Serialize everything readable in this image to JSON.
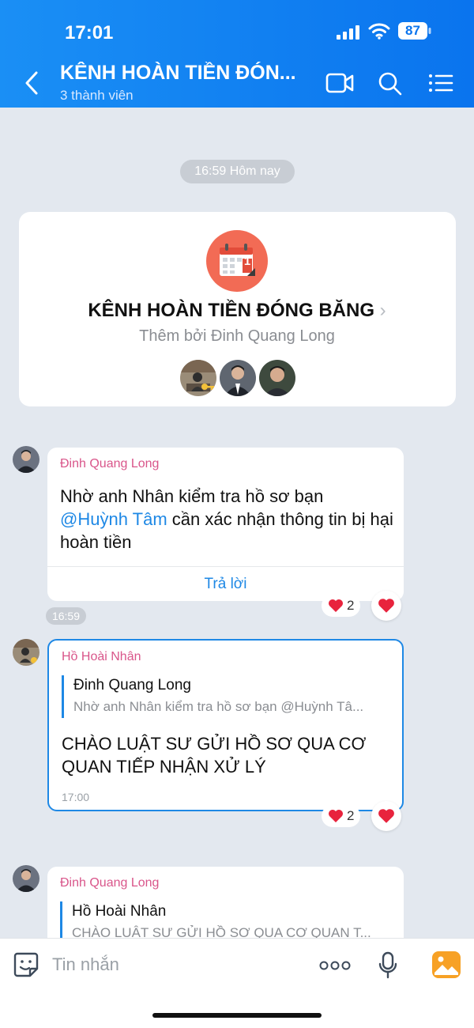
{
  "status": {
    "time": "17:01",
    "battery": "87"
  },
  "header": {
    "title": "KÊNH HOÀN TIỀN ĐÓN...",
    "subtitle": "3 thành viên"
  },
  "date_pill": "16:59 Hôm nay",
  "group_card": {
    "title": "KÊNH HOÀN TIỀN ĐÓNG BĂNG",
    "subtitle": "Thêm bởi Đinh Quang Long",
    "calendar_day": "1"
  },
  "messages": [
    {
      "sender": "Đinh Quang Long",
      "text_before": "Nhờ anh Nhân kiểm tra hồ sơ bạn",
      "mention": "@Huỳnh Tâm",
      "text_after": "cần xác nhận thông tin bị hại hoàn tiền",
      "reply_label": "Trả lời",
      "time": "16:59",
      "reactions": "2"
    },
    {
      "sender": "Hồ Hoài Nhân",
      "quote_name": "Đinh Quang Long",
      "quote_text": "Nhờ anh Nhân kiểm tra hồ sơ bạn @Huỳnh Tâ...",
      "text": "CHÀO LUẬT SƯ GỬI HỒ SƠ QUA CƠ QUAN TIẾP NHẬN XỬ LÝ",
      "time": "17:00",
      "reactions": "2"
    },
    {
      "sender": "Đinh Quang Long",
      "quote_name": "Hồ Hoài Nhân",
      "quote_text": "CHÀO LUẬT SƯ GỬI HỒ SƠ QUA CƠ QUAN T..."
    }
  ],
  "input": {
    "placeholder": "Tin nhắn"
  },
  "colors": {
    "header": "#0a74ee",
    "accent": "#1e88e5",
    "sender": "#d9558a",
    "background": "#e3e8ef",
    "heart": "#e8233d"
  },
  "icons": [
    "back-icon",
    "video-call-icon",
    "search-icon",
    "menu-icon",
    "heart-icon",
    "sticker-icon",
    "more-icon",
    "mic-icon",
    "gallery-icon"
  ]
}
